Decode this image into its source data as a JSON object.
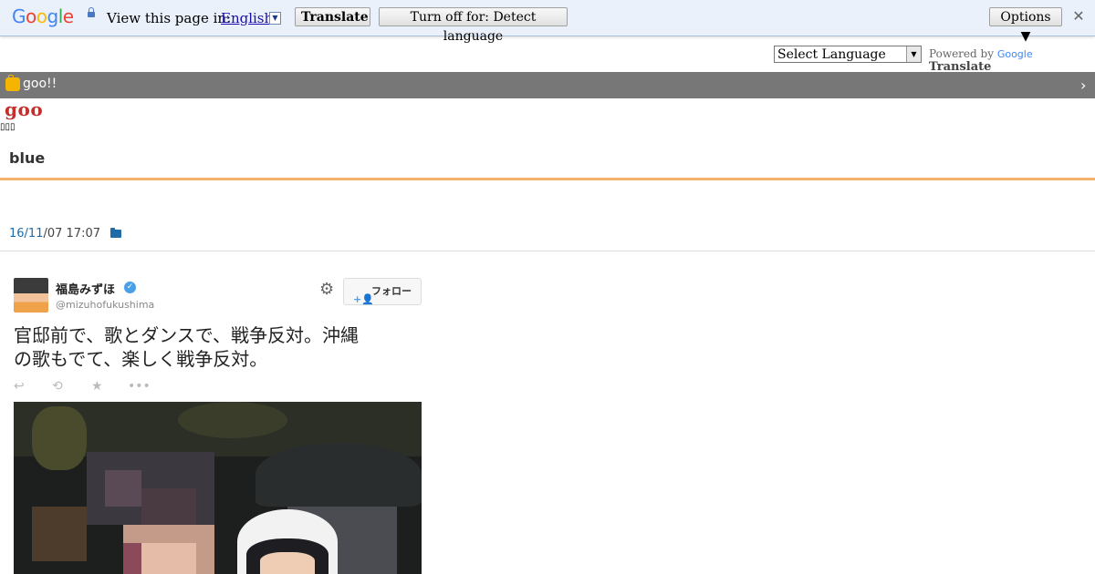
{
  "translate_bar": {
    "logo_letters": [
      {
        "ch": "G",
        "color": "#4285f4"
      },
      {
        "ch": "o",
        "color": "#ea4335"
      },
      {
        "ch": "o",
        "color": "#fbbc05"
      },
      {
        "ch": "g",
        "color": "#4285f4"
      },
      {
        "ch": "l",
        "color": "#34a853"
      },
      {
        "ch": "e",
        "color": "#ea4335"
      }
    ],
    "view_text": "View this page in:",
    "language": "English",
    "translate_label": "Translate",
    "turnoff_label": "Turn off for: Detect language",
    "options_label": "Options ▼",
    "close_glyph": "✕"
  },
  "language_selector": {
    "selected": "Select Language",
    "powered_by": "Powered by",
    "google": "Google",
    "translate": "Translate"
  },
  "goo_bar": {
    "label": "goo!!",
    "chevron": "›"
  },
  "blog": {
    "logo": "goo",
    "tofu": "▯▯▯",
    "title": "blue"
  },
  "post": {
    "date_link": "16/11",
    "date_rest": "/07 17:07"
  },
  "tweet": {
    "name": "福島みずほ",
    "handle": "@mizuhofukushima",
    "follow_label": "フォロー",
    "text_line1": "官邸前で、歌とダンスで、戦争反対。沖縄",
    "text_line2": "の歌もでて、楽しく戦争反対。",
    "actions": [
      "↩",
      "⟲",
      "★",
      "•••"
    ]
  },
  "colors": {
    "goo_bar": "#777777",
    "orange_rule": "#f5b26b",
    "link_blue": "#1e6ba8",
    "goo_red": "#c4302b"
  }
}
